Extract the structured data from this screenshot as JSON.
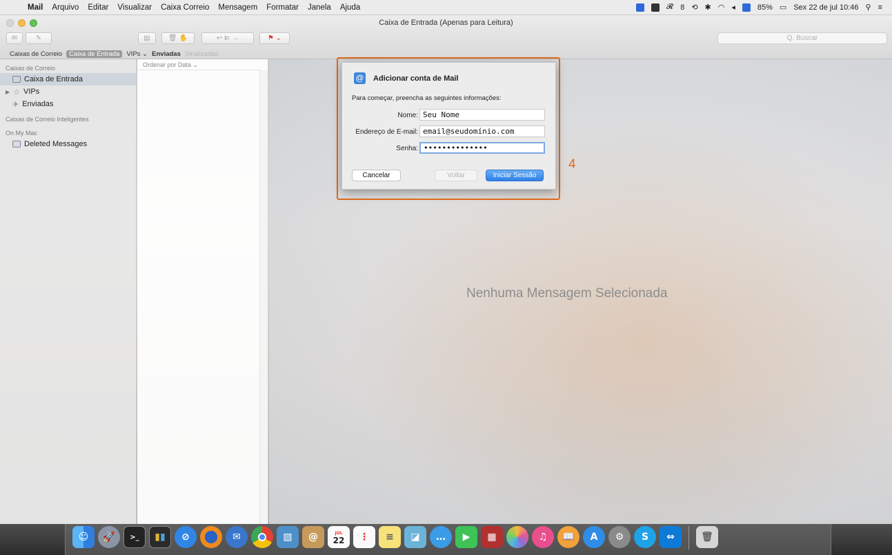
{
  "menubar": {
    "apple": "",
    "app": "Mail",
    "items": [
      "Arquivo",
      "Editar",
      "Visualizar",
      "Caixa Correio",
      "Mensagem",
      "Formatar",
      "Janela",
      "Ajuda"
    ],
    "status": {
      "battery": "85%",
      "datetime": "Sex 22 de jul 10:46",
      "extra": "8"
    }
  },
  "window": {
    "title": "Caixa de Entrada (Apenas para Leitura)",
    "search_placeholder": "Q. Buscar"
  },
  "favbar": {
    "mailboxes": "Caixas de Correio",
    "inbox": "Caixa de Entrada",
    "vips": "VIPs ⌄",
    "sent": "Enviadas",
    "flagged": "Sinalizadas"
  },
  "sidebar": {
    "section1": "Caixas de Correio",
    "inbox": "Caixa de Entrada",
    "vips": "VIPs",
    "sent": "Enviadas",
    "section2": "Caixas de Correio Inteligentes",
    "section3": "On My Mac",
    "deleted": "Deleted Messages"
  },
  "list": {
    "sort": "Ordenar por Data ⌄"
  },
  "content": {
    "empty": "Nenhuma Mensagem Selecionada"
  },
  "dialog": {
    "title": "Adicionar conta de Mail",
    "subtitle": "Para começar, preencha as seguintes informações:",
    "name_label": "Nome:",
    "name_value": "Seu Nome",
    "email_label": "Endereço de E-mail:",
    "email_value": "email@seudomínio.com",
    "password_label": "Senha:",
    "password_value": "••••••••••••••",
    "cancel": "Cancelar",
    "back": "Voltar",
    "login": "Iniciar Sessão"
  },
  "annotation": {
    "step": "4",
    "color": "#e06b1c"
  },
  "dock": {
    "calendar_day": "22",
    "calendar_month": "JUL",
    "icons": [
      "finder-icon",
      "launchpad-icon",
      "terminal-icon",
      "activity-icon",
      "safari-icon",
      "firefox-icon",
      "thunderbird-icon",
      "chrome-icon",
      "preview-icon",
      "contacts-icon",
      "calendar-icon",
      "reminders-icon",
      "notes-icon",
      "photo-viewer-icon",
      "messages-icon",
      "facetime-icon",
      "photo-booth-icon",
      "photos-icon",
      "itunes-icon",
      "ibooks-icon",
      "app-store-icon",
      "system-preferences-icon",
      "skype-icon",
      "teamviewer-icon",
      "trash-icon"
    ]
  }
}
